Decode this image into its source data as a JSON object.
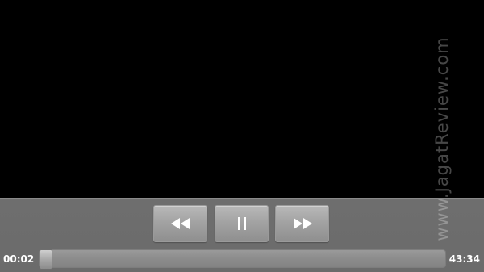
{
  "player": {
    "current_time": "00:02",
    "total_time": "43:34",
    "progress": 0.001,
    "state": "playing"
  },
  "controls": {
    "rewind_icon": "rewind-icon",
    "pause_icon": "pause-icon",
    "fast_forward_icon": "fast-forward-icon"
  },
  "watermark": "www.JagatReview.com",
  "colors": {
    "video_background": "#000000",
    "control_bar": "#6b6b6b",
    "button": "#a3a3a3",
    "icon": "#ffffff"
  }
}
